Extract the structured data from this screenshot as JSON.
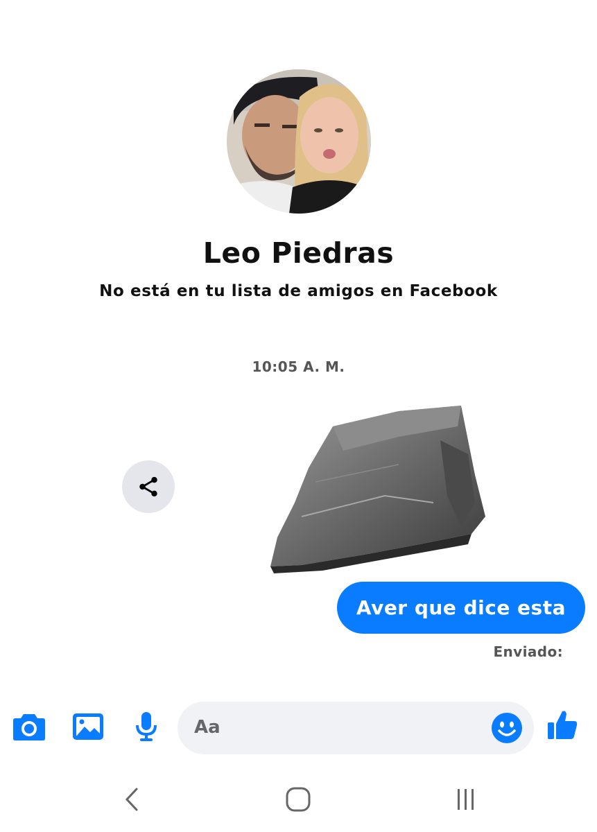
{
  "profile": {
    "name": "Leo Piedras",
    "subtitle": "No está en tu lista de amigos en Facebook"
  },
  "conversation": {
    "timestamp": "10:05 A. M.",
    "outgoing_message": "Aver que dice esta",
    "delivery_status": "Enviado:"
  },
  "composer": {
    "placeholder": "Aa",
    "icons": [
      "camera-icon",
      "image-icon",
      "microphone-icon",
      "emoji-icon",
      "thumbs-up-icon"
    ]
  },
  "navbar": {
    "icons": [
      "back-icon",
      "home-icon",
      "recents-icon"
    ]
  },
  "colors": {
    "accent": "#0a7cff",
    "bubble_text": "#ffffff",
    "share_bg": "#e4e6eb",
    "input_bg": "#f0f2f5",
    "muted_text": "#555555"
  }
}
